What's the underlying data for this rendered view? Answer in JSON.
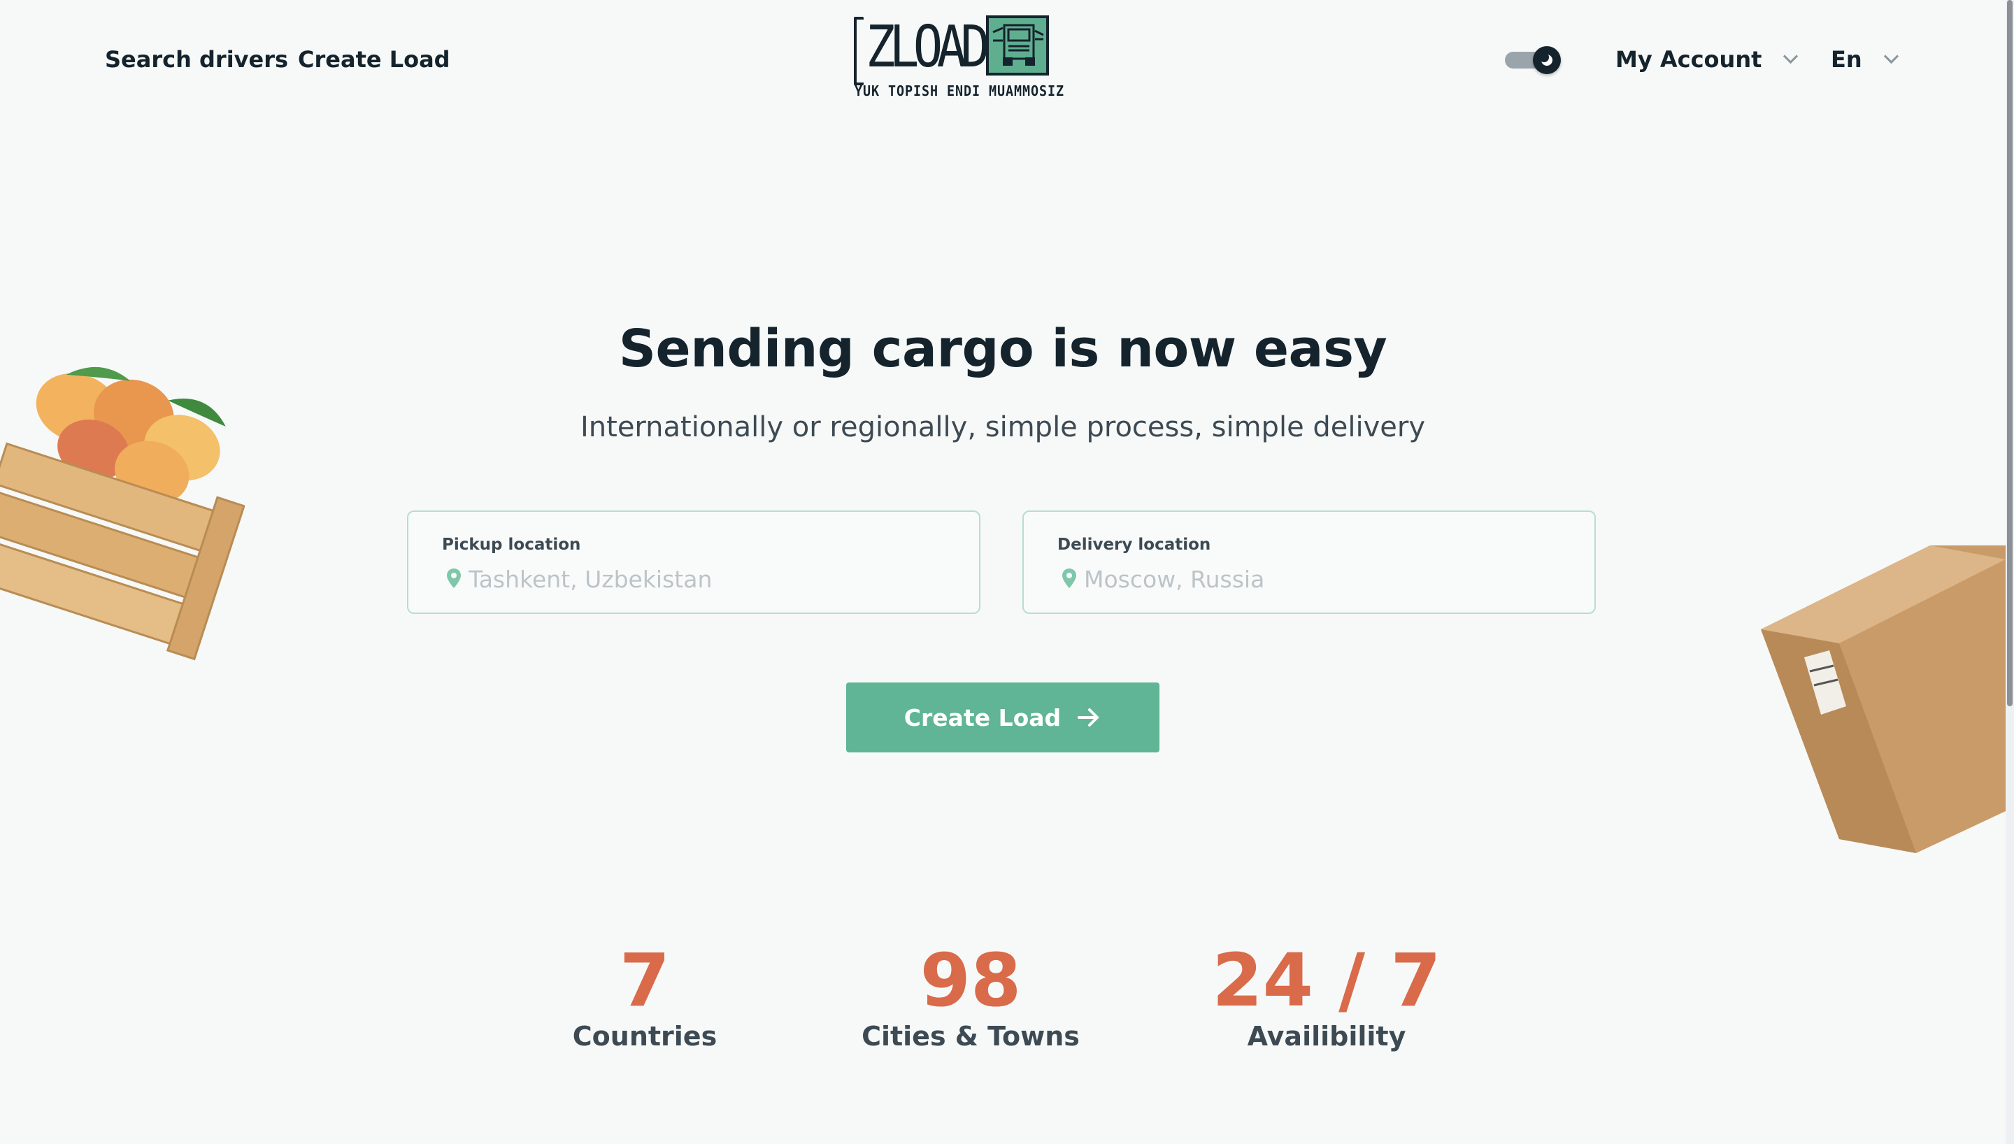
{
  "header": {
    "nav": [
      {
        "label": "Search drivers"
      },
      {
        "label": "Create Load"
      }
    ],
    "logo": {
      "word": "ZLOAD",
      "tagline": "YUK TOPISH ENDI MUAMMOSIZ"
    },
    "theme_toggle": {
      "state": "dark"
    },
    "account_label": "My Account",
    "language_label": "En"
  },
  "hero": {
    "title": "Sending cargo is now easy",
    "subtitle": "Internationally or regionally, simple process, simple delivery"
  },
  "form": {
    "pickup": {
      "label": "Pickup location",
      "placeholder": "Tashkent, Uzbekistan"
    },
    "delivery": {
      "label": "Delivery location",
      "placeholder": "Moscow, Russia"
    },
    "submit_label": "Create Load"
  },
  "stats": [
    {
      "value": "7",
      "label": "Countries"
    },
    {
      "value": "98",
      "label": "Cities & Towns"
    },
    {
      "value": "24 / 7",
      "label": "Availibility"
    }
  ],
  "colors": {
    "accent": "#5fb596",
    "stat_number": "#d96a4a",
    "text_dark": "#15232d",
    "background": "#f6f9f8"
  },
  "icons": {
    "toggle": "moon-toggle-icon",
    "dropdown": "chevron-down-icon",
    "field_pin": "location-pin-icon",
    "cta_arrow": "arrow-right-icon"
  }
}
